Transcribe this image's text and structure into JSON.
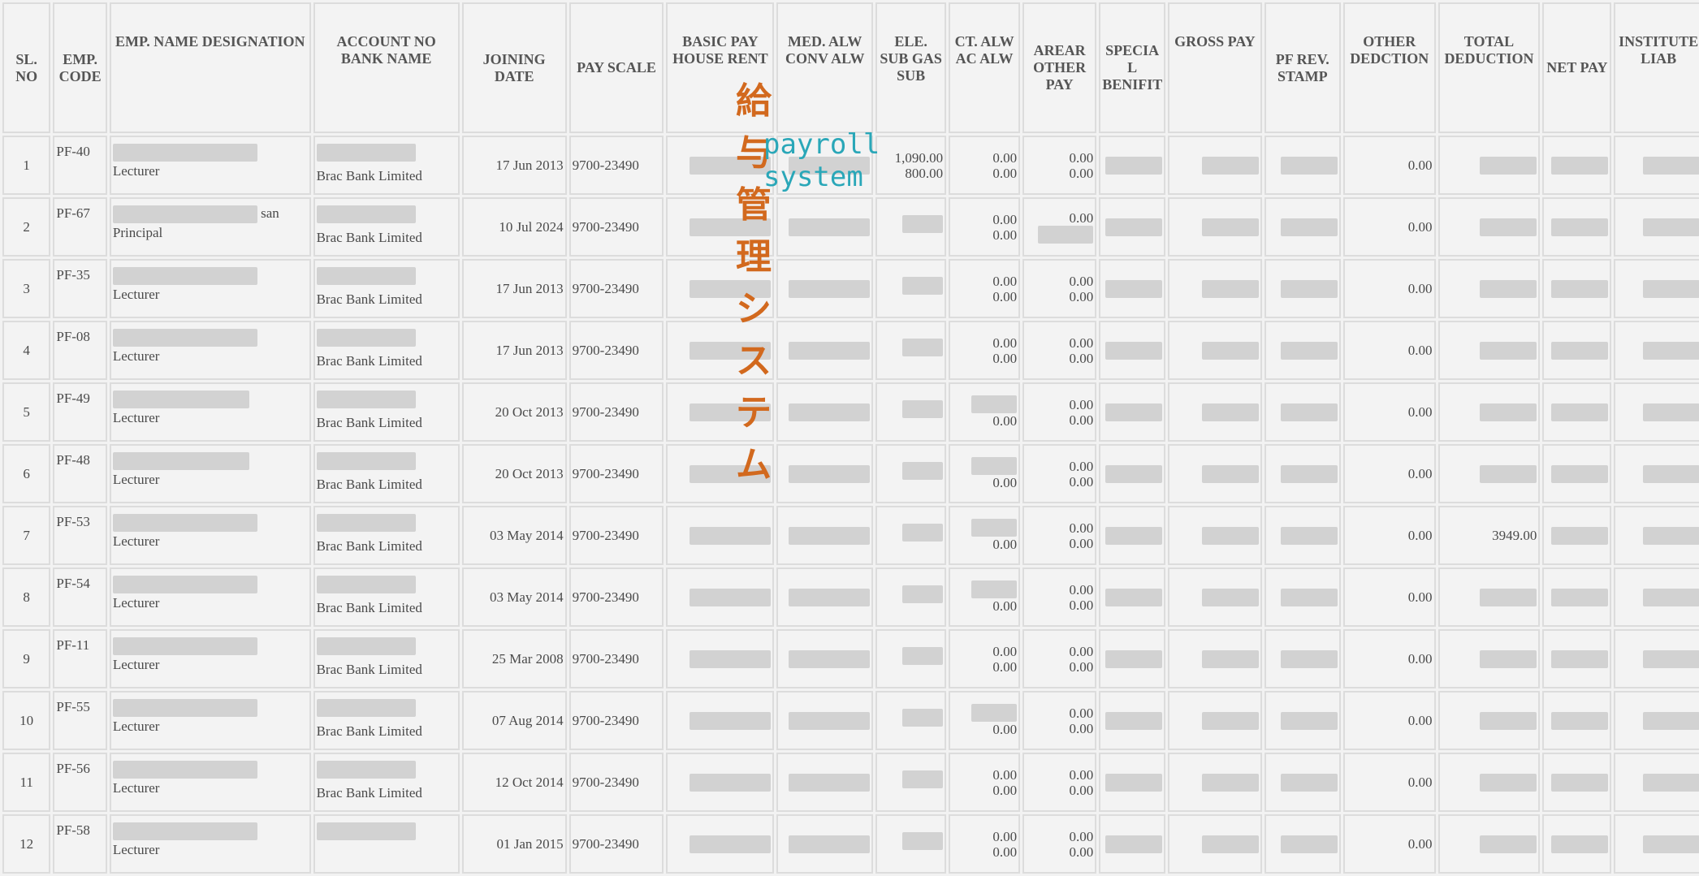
{
  "headers": {
    "sl": "SL. NO",
    "emp_code": "EMP. CODE",
    "name_desig": "EMP. NAME DESIGNATION",
    "account_bank": "ACCOUNT NO BANK NAME",
    "joining": "JOINING DATE",
    "pay_scale": "PAY SCALE",
    "basic_house": "BASIC PAY HOUSE RENT",
    "med_conv": "MED. ALW CONV ALW",
    "ele_gas": "ELE. SUB GAS SUB",
    "ct_ac": "CT. ALW AC ALW",
    "arear_other": "AREAR OTHER PAY",
    "special": "SPECIA L BENIFIT",
    "gross": "GROSS PAY",
    "pf_stamp": "PF REV. STAMP",
    "other_ded": "OTHER DEDCTION",
    "total_ded": "TOTAL DEDUCTION",
    "net_pay": "NET PAY",
    "institute": "INSTITUTE LIAB"
  },
  "watermark": {
    "japanese": "給与管理システム",
    "english": "payroll system"
  },
  "rows": [
    {
      "sl": "1",
      "code": "PF-40",
      "name_tail": "",
      "designation": "Lecturer",
      "bank": "Brac Bank Limited",
      "joining": "17 Jun 2013",
      "scale": "9700-23490",
      "ele_top": "1,090.00",
      "ele_bottom": "800.00",
      "ct1": "0.00",
      "ct2": "0.00",
      "ar1": "0.00",
      "ar2": "0.00",
      "other_ded": "0.00",
      "total_ded": ""
    },
    {
      "sl": "2",
      "code": "PF-67",
      "name_tail": "san",
      "designation": "Principal",
      "bank": "Brac Bank Limited",
      "joining": "10 Jul 2024",
      "scale": "9700-23490",
      "ele_top": "",
      "ele_bottom": "",
      "ct1": "0.00",
      "ct2": "0.00",
      "ar1": "0.00",
      "ar2": "",
      "other_ded": "0.00",
      "total_ded": ""
    },
    {
      "sl": "3",
      "code": "PF-35",
      "name_tail": "",
      "designation": "Lecturer",
      "bank": "Brac Bank Limited",
      "joining": "17 Jun 2013",
      "scale": "9700-23490",
      "ele_top": "",
      "ele_bottom": "",
      "ct1": "0.00",
      "ct2": "0.00",
      "ar1": "0.00",
      "ar2": "0.00",
      "other_ded": "0.00",
      "total_ded": ""
    },
    {
      "sl": "4",
      "code": "PF-08",
      "name_tail": "",
      "designation": "Lecturer",
      "bank": "Brac Bank Limited",
      "joining": "17 Jun 2013",
      "scale": "9700-23490",
      "ele_top": "",
      "ele_bottom": "",
      "ct1": "0.00",
      "ct2": "0.00",
      "ar1": "0.00",
      "ar2": "0.00",
      "other_ded": "0.00",
      "total_ded": ""
    },
    {
      "sl": "5",
      "code": "PF-49",
      "name_tail": "",
      "designation": "Lecturer",
      "bank": "Brac Bank Limited",
      "joining": "20 Oct 2013",
      "scale": "9700-23490",
      "ele_top": "",
      "ele_bottom": "",
      "ct1": "",
      "ct2": "0.00",
      "ar1": "0.00",
      "ar2": "0.00",
      "other_ded": "0.00",
      "total_ded": ""
    },
    {
      "sl": "6",
      "code": "PF-48",
      "name_tail": "",
      "designation": "Lecturer",
      "bank": "Brac Bank Limited",
      "joining": "20 Oct 2013",
      "scale": "9700-23490",
      "ele_top": "",
      "ele_bottom": "",
      "ct1": "",
      "ct2": "0.00",
      "ar1": "0.00",
      "ar2": "0.00",
      "other_ded": "0.00",
      "total_ded": ""
    },
    {
      "sl": "7",
      "code": "PF-53",
      "name_tail": "",
      "designation": "Lecturer",
      "bank": "Brac Bank Limited",
      "joining": "03 May 2014",
      "scale": "9700-23490",
      "ele_top": "",
      "ele_bottom": "",
      "ct1": "",
      "ct2": "0.00",
      "ar1": "0.00",
      "ar2": "0.00",
      "other_ded": "0.00",
      "total_ded": "3949.00"
    },
    {
      "sl": "8",
      "code": "PF-54",
      "name_tail": "",
      "designation": "Lecturer",
      "bank": "Brac Bank Limited",
      "joining": "03 May 2014",
      "scale": "9700-23490",
      "ele_top": "",
      "ele_bottom": "",
      "ct1": "",
      "ct2": "0.00",
      "ar1": "0.00",
      "ar2": "0.00",
      "other_ded": "0.00",
      "total_ded": ""
    },
    {
      "sl": "9",
      "code": "PF-11",
      "name_tail": "",
      "designation": "Lecturer",
      "bank": "Brac Bank Limited",
      "joining": "25 Mar 2008",
      "scale": "9700-23490",
      "ele_top": "",
      "ele_bottom": "",
      "ct1": "0.00",
      "ct2": "0.00",
      "ar1": "0.00",
      "ar2": "0.00",
      "other_ded": "0.00",
      "total_ded": ""
    },
    {
      "sl": "10",
      "code": "PF-55",
      "name_tail": "",
      "designation": "Lecturer",
      "bank": "Brac Bank Limited",
      "joining": "07 Aug 2014",
      "scale": "9700-23490",
      "ele_top": "",
      "ele_bottom": "",
      "ct1": "",
      "ct2": "0.00",
      "ar1": "0.00",
      "ar2": "0.00",
      "other_ded": "0.00",
      "total_ded": ""
    },
    {
      "sl": "11",
      "code": "PF-56",
      "name_tail": "",
      "designation": "Lecturer",
      "bank": "Brac Bank Limited",
      "joining": "12 Oct 2014",
      "scale": "9700-23490",
      "ele_top": "",
      "ele_bottom": "",
      "ct1": "0.00",
      "ct2": "0.00",
      "ar1": "0.00",
      "ar2": "0.00",
      "other_ded": "0.00",
      "total_ded": ""
    },
    {
      "sl": "12",
      "code": "PF-58",
      "name_tail": "",
      "designation": "Lecturer",
      "bank": "",
      "joining": "01 Jan 2015",
      "scale": "9700-23490",
      "ele_top": "",
      "ele_bottom": "",
      "ct1": "0.00",
      "ct2": "0.00",
      "ar1": "0.00",
      "ar2": "0.00",
      "other_ded": "0.00",
      "total_ded": ""
    }
  ]
}
